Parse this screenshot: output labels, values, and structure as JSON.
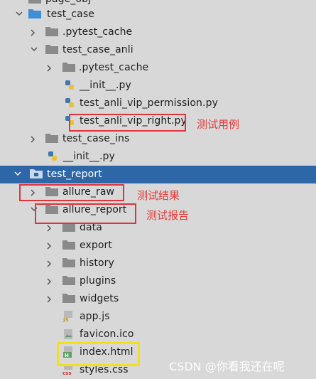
{
  "tree": {
    "page_obj": "page_obj",
    "test_case": "test_case",
    "pytest_cache_1": ".pytest_cache",
    "test_case_anli": "test_case_anli",
    "pytest_cache_2": ".pytest_cache",
    "init_anli": "__init__.py",
    "vip_permission": "test_anli_vip_permission.py",
    "vip_right": "test_anli_vip_right.py",
    "test_case_ins": "test_case_ins",
    "init_case": "__init__.py",
    "test_report": "test_report",
    "allure_raw": "allure_raw",
    "allure_report": "allure_report",
    "data": "data",
    "export": "export",
    "history": "history",
    "plugins": "plugins",
    "widgets": "widgets",
    "app_js": "app.js",
    "favicon": "favicon.ico",
    "index_html": "index.html",
    "styles_css": "styles.css"
  },
  "annotations": {
    "test_case_label": "测试用例",
    "test_result_label": "测试结果",
    "test_report_label": "测试报告"
  },
  "icon_badges": {
    "js": "JS",
    "html": "H",
    "css": "css"
  },
  "watermark": "CSDN @你看我还在呢",
  "colors": {
    "selection": "#2d67a8",
    "background": "#d8d8d8",
    "annotation_red": "#e83a3a",
    "highlight_yellow": "#f2e01e"
  }
}
